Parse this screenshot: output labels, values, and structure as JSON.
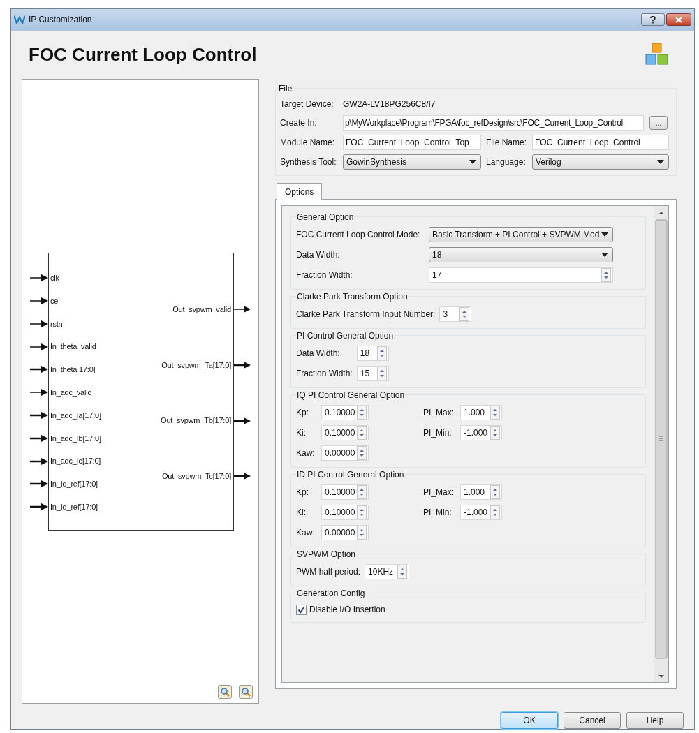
{
  "window": {
    "title": "IP Customization"
  },
  "header": {
    "title": "FOC Current Loop Control"
  },
  "diagram": {
    "inputs": [
      "clk",
      "ce",
      "rstn",
      "In_theta_valid",
      "In_theta[17:0]",
      "In_adc_valid",
      "In_adc_Ia[17:0]",
      "In_adc_Ib[17:0]",
      "In_adc_Ic[17:0]",
      "In_Iq_ref[17:0]",
      "In_Id_ref[17:0]"
    ],
    "outputs": [
      "Out_svpwm_valid",
      "Out_svpwm_Ta[17:0]",
      "Out_svpwm_Tb[17:0]",
      "Out_svpwm_Tc[17:0]"
    ]
  },
  "file": {
    "title": "File",
    "target_device": {
      "label": "Target Device:",
      "value": "GW2A-LV18PG256C8/I7"
    },
    "create_in": {
      "label": "Create In:",
      "value": "p\\MyWorkplace\\Program\\FPGA\\foc_refDesign\\src\\FOC_Current_Loop_Control",
      "browse": "..."
    },
    "module_name": {
      "label": "Module Name:",
      "value": "FOC_Current_Loop_Control_Top"
    },
    "file_name": {
      "label": "File Name:",
      "value": "FOC_Current_Loop_Control"
    },
    "synthesis_tool": {
      "label": "Synthesis Tool:",
      "value": "GowinSynthesis"
    },
    "language": {
      "label": "Language:",
      "value": "Verilog"
    }
  },
  "tabs": [
    {
      "label": "Options",
      "selected": true
    }
  ],
  "sections": [
    {
      "title": "General Option",
      "kind": "wide",
      "rows": [
        [
          {
            "label": "FOC Current Loop Control Mode:",
            "kind": "dropdown",
            "value": "Basic Transform + PI Control + SVPWM Mod"
          }
        ],
        [
          {
            "label": "Data Width:",
            "kind": "dropdown",
            "value": "18"
          }
        ],
        [
          {
            "label": "Fraction Width:",
            "kind": "spin",
            "value": "17"
          }
        ]
      ]
    },
    {
      "title": "Clarke Park Transform Option",
      "kind": "compact",
      "rows": [
        [
          {
            "label": "Clarke Park Transform Input Number:",
            "kind": "spin",
            "value": "3"
          }
        ]
      ]
    },
    {
      "title": "PI Control General Option",
      "kind": "compact",
      "rows": [
        [
          {
            "label": "Data Width:",
            "kind": "spin",
            "value": "18"
          }
        ],
        [
          {
            "label": "Fraction Width:",
            "kind": "spin",
            "value": "15"
          }
        ]
      ]
    },
    {
      "title": "IQ PI Control General Option",
      "kind": "pairs",
      "rows": [
        [
          {
            "label": "Kp:",
            "kind": "spin",
            "value": "0.10000"
          },
          {
            "label": "PI_Max:",
            "kind": "spin",
            "value": "1.000"
          }
        ],
        [
          {
            "label": "Ki:",
            "kind": "spin",
            "value": "0.10000"
          },
          {
            "label": "PI_Min:",
            "kind": "spin",
            "value": "-1.000"
          }
        ],
        [
          {
            "label": "Kaw:",
            "kind": "spin",
            "value": "0.00000"
          }
        ]
      ]
    },
    {
      "title": "ID PI Control General Option",
      "kind": "pairs",
      "rows": [
        [
          {
            "label": "Kp:",
            "kind": "spin",
            "value": "0.10000"
          },
          {
            "label": "PI_Max:",
            "kind": "spin",
            "value": "1.000"
          }
        ],
        [
          {
            "label": "Ki:",
            "kind": "spin",
            "value": "0.10000"
          },
          {
            "label": "PI_Min:",
            "kind": "spin",
            "value": "-1.000"
          }
        ],
        [
          {
            "label": "Kaw:",
            "kind": "spin",
            "value": "0.00000"
          }
        ]
      ]
    },
    {
      "title": "SVPWM Option",
      "kind": "compact",
      "rows": [
        [
          {
            "label": "PWM half period:",
            "kind": "spin",
            "value": "10KHz"
          }
        ]
      ]
    },
    {
      "title": "Generation Config",
      "kind": "compact",
      "rows": [
        [
          {
            "label": "Disable I/O Insertion",
            "kind": "checkbox",
            "checked": true
          }
        ]
      ]
    }
  ],
  "buttons": [
    {
      "label": "OK",
      "focused": true
    },
    {
      "label": "Cancel",
      "focused": false
    },
    {
      "label": "Help",
      "focused": false
    }
  ]
}
